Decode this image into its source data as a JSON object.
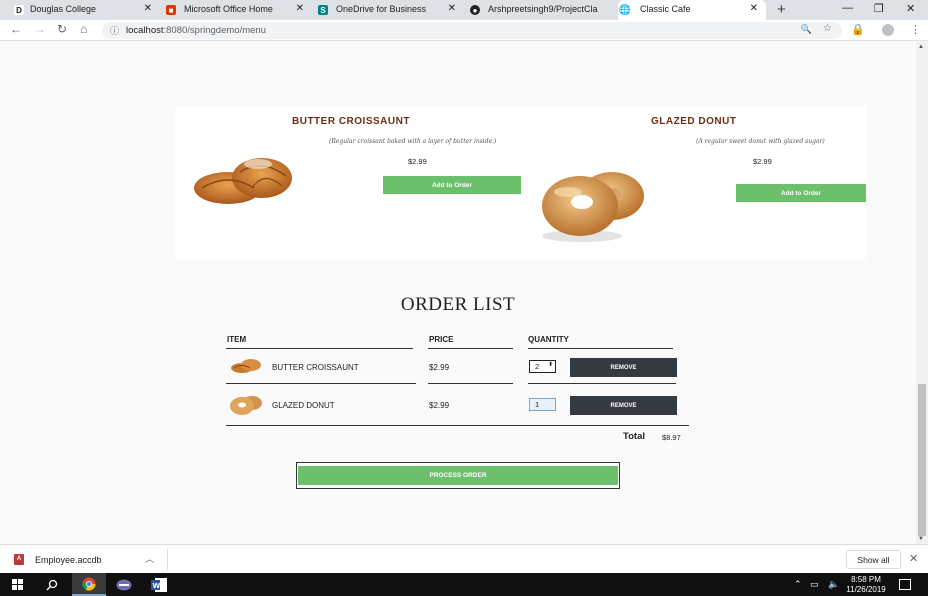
{
  "browser": {
    "tabs": [
      {
        "title": "Douglas College",
        "icon": "D"
      },
      {
        "title": "Microsoft Office Home",
        "icon": "office-icon"
      },
      {
        "title": "OneDrive for Business",
        "icon": "S"
      },
      {
        "title": "Arshpreetsingh9/ProjectCla",
        "icon": "github-icon"
      },
      {
        "title": "Classic Cafe",
        "icon": "globe-icon",
        "active": true
      }
    ],
    "url_host": "localhost",
    "url_path": ":8080/springdemo/menu"
  },
  "menu": {
    "products": [
      {
        "name": "BUTTER CROISSAUNT",
        "description": "(Regular croissant baked with a layer of butter inside.)",
        "price": "$2.99",
        "button": "Add to Order"
      },
      {
        "name": "GLAZED DONUT",
        "description": "(A regular sweet donut with glazed sugar)",
        "price": "$2.99",
        "button": "Add to Order"
      }
    ]
  },
  "order": {
    "title": "ORDER LIST",
    "headers": {
      "item": "ITEM",
      "price": "PRICE",
      "quantity": "QUANTITY"
    },
    "rows": [
      {
        "name": "BUTTER CROISSAUNT",
        "price": "$2.99",
        "quantity": "2",
        "remove": "REMOVE"
      },
      {
        "name": "GLAZED DONUT",
        "price": "$2.99",
        "quantity": "1",
        "remove": "REMOVE"
      }
    ],
    "total_label": "Total",
    "total_value": "$8.97",
    "process_button": "PROCESS ORDER"
  },
  "downloads": {
    "file": "Employee.accdb",
    "show_all": "Show all"
  },
  "taskbar": {
    "time": "8:58 PM",
    "date": "11/26/2019"
  },
  "colors": {
    "accent_green": "#6cbf6b",
    "title_brown": "#6b2e14",
    "dark_button": "#343a40"
  }
}
